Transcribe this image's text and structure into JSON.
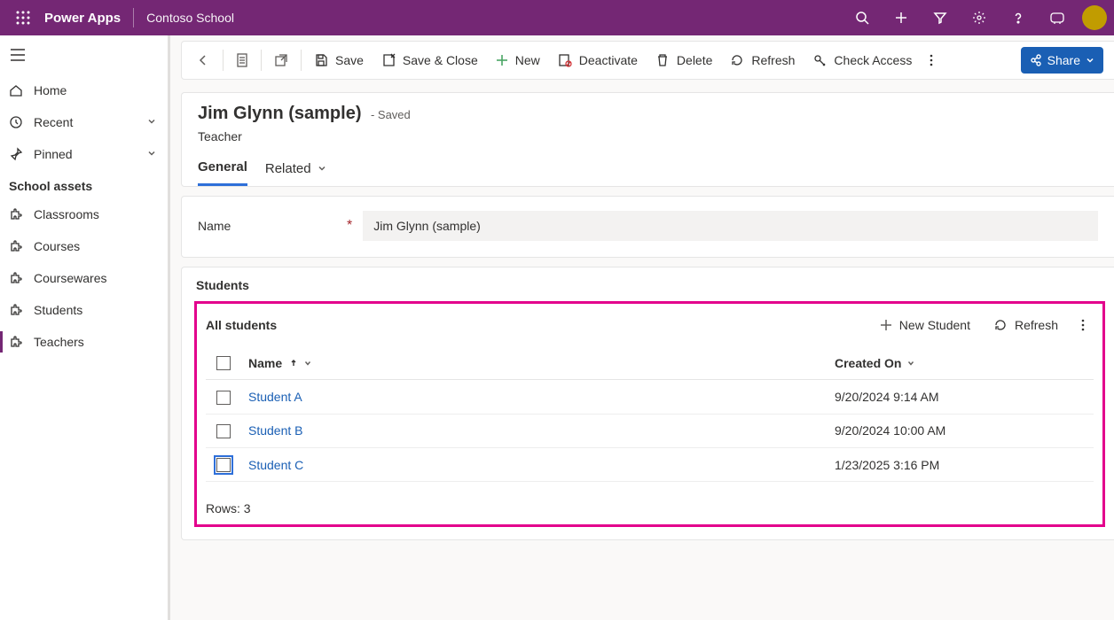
{
  "topbar": {
    "brand": "Power Apps",
    "app": "Contoso School"
  },
  "sidebar": {
    "home": "Home",
    "recent": "Recent",
    "pinned": "Pinned",
    "group": "School assets",
    "items": [
      {
        "label": "Classrooms"
      },
      {
        "label": "Courses"
      },
      {
        "label": "Coursewares"
      },
      {
        "label": "Students"
      },
      {
        "label": "Teachers"
      }
    ]
  },
  "commands": {
    "save": "Save",
    "saveclose": "Save & Close",
    "new": "New",
    "deactivate": "Deactivate",
    "delete": "Delete",
    "refresh": "Refresh",
    "checkaccess": "Check Access",
    "share": "Share"
  },
  "record": {
    "title": "Jim Glynn (sample)",
    "statusPrefix": "- ",
    "status": "Saved",
    "entity": "Teacher",
    "tabs": {
      "general": "General",
      "related": "Related"
    }
  },
  "form": {
    "name_label": "Name",
    "name_value": "Jim Glynn (sample)"
  },
  "subgrid": {
    "section": "Students",
    "view": "All students",
    "new_btn": "New Student",
    "refresh_btn": "Refresh",
    "col_name": "Name",
    "col_created": "Created On",
    "rows": [
      {
        "name": "Student A",
        "created": "9/20/2024 9:14 AM"
      },
      {
        "name": "Student B",
        "created": "9/20/2024 10:00 AM"
      },
      {
        "name": "Student C",
        "created": "1/23/2025 3:16 PM"
      }
    ],
    "footer_label": "Rows: ",
    "footer_count": "3"
  }
}
